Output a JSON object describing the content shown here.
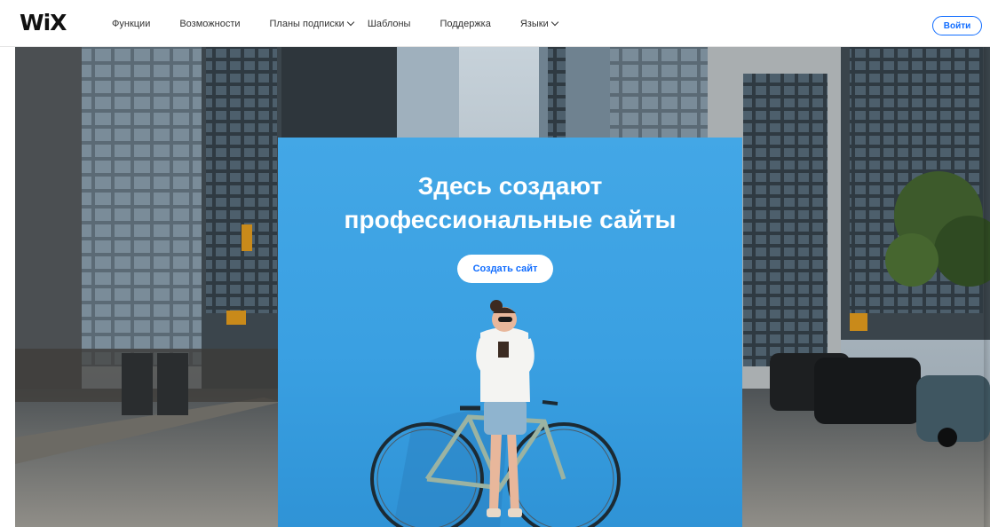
{
  "brand": {
    "logo_text": "WiX",
    "accent": "#116dff"
  },
  "nav": {
    "items": [
      {
        "label": "Функции",
        "dropdown": false
      },
      {
        "label": "Возможности",
        "dropdown": false
      },
      {
        "label": "Планы подписки",
        "dropdown": true
      },
      {
        "label": "Шаблоны",
        "dropdown": false
      },
      {
        "label": "Поддержка",
        "dropdown": false
      },
      {
        "label": "Языки",
        "dropdown": true
      }
    ],
    "login_label": "Войти"
  },
  "hero": {
    "headline_line1": "Здесь создают",
    "headline_line2": "профессиональные сайты",
    "cta_label": "Создать сайт",
    "card_color": "#3ea3e4"
  }
}
